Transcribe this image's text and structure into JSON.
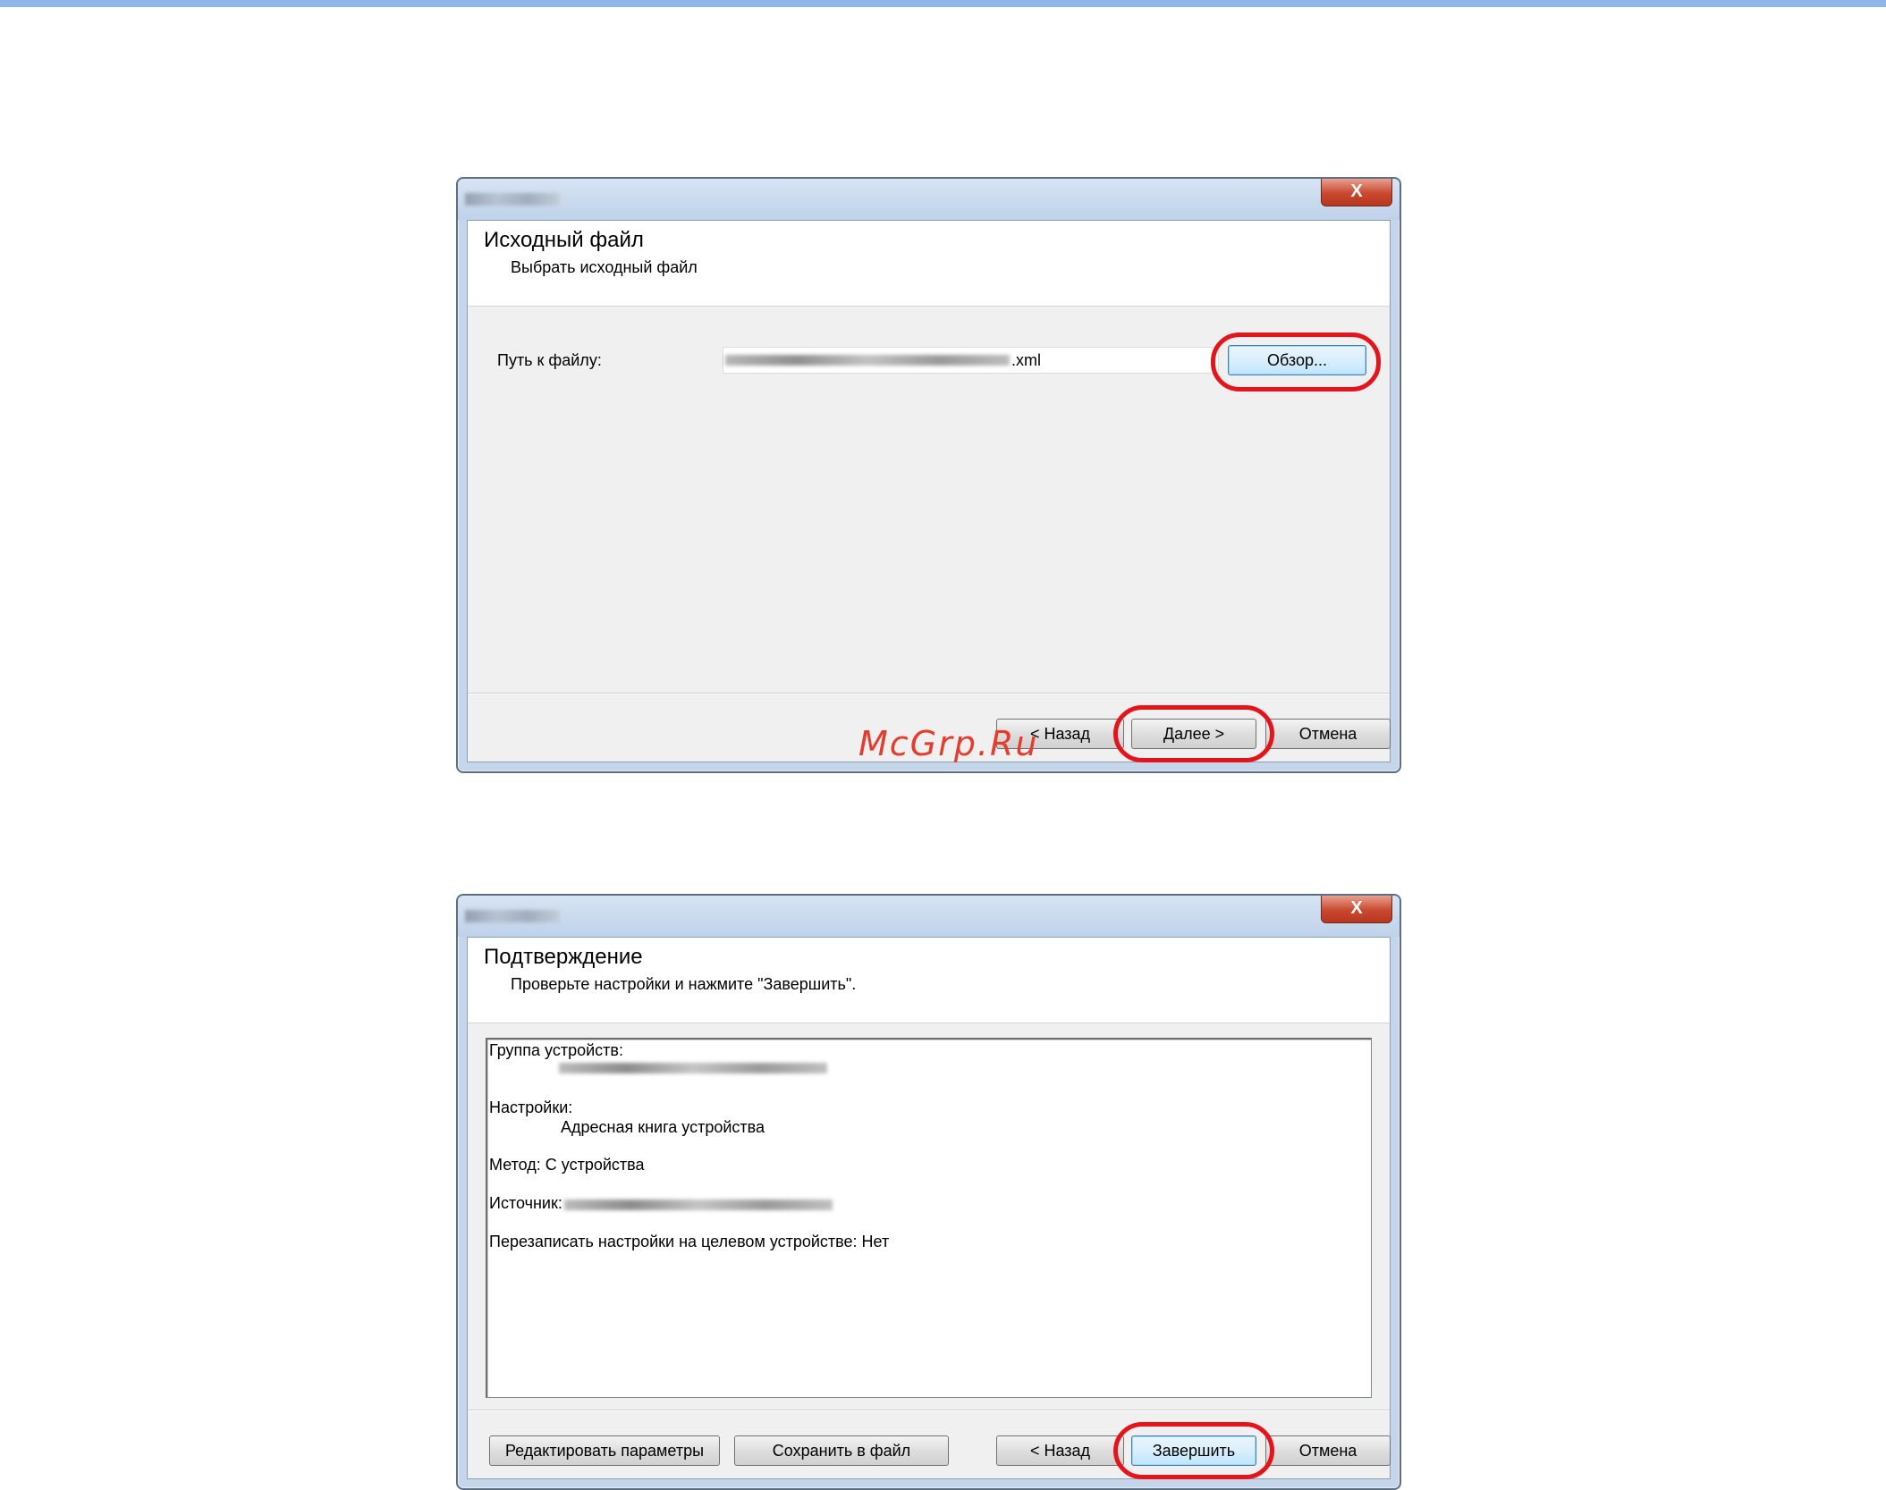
{
  "window1": {
    "close_glyph": "X",
    "header_title": "Исходный файл",
    "header_subtitle": "Выбрать исходный файл",
    "path_label": "Путь к файлу:",
    "path_value_suffix": ".xml",
    "browse_button": "Обзор...",
    "back_button": "< Назад",
    "next_button": "Далее >",
    "cancel_button": "Отмена"
  },
  "window2": {
    "close_glyph": "X",
    "header_title": "Подтверждение",
    "header_subtitle": "Проверьте настройки и нажмите \"Завершить\".",
    "summary": {
      "device_group_label": "Группа устройств:",
      "settings_label": "Настройки:",
      "settings_value": "Адресная книга устройства",
      "method_line": "Метод: С устройства",
      "source_label": "Источник:",
      "overwrite_line": "Перезаписать настройки на целевом устройстве: Нет"
    },
    "edit_button": "Редактировать параметры",
    "save_button": "Сохранить в файл",
    "back_button": "< Назад",
    "finish_button": "Завершить",
    "cancel_button": "Отмена"
  },
  "watermark": "McGrp.Ru",
  "colors": {
    "highlight_circle": "#e5141b",
    "watermark": "#e53d2d",
    "top_bar": "#8fb6ea"
  }
}
